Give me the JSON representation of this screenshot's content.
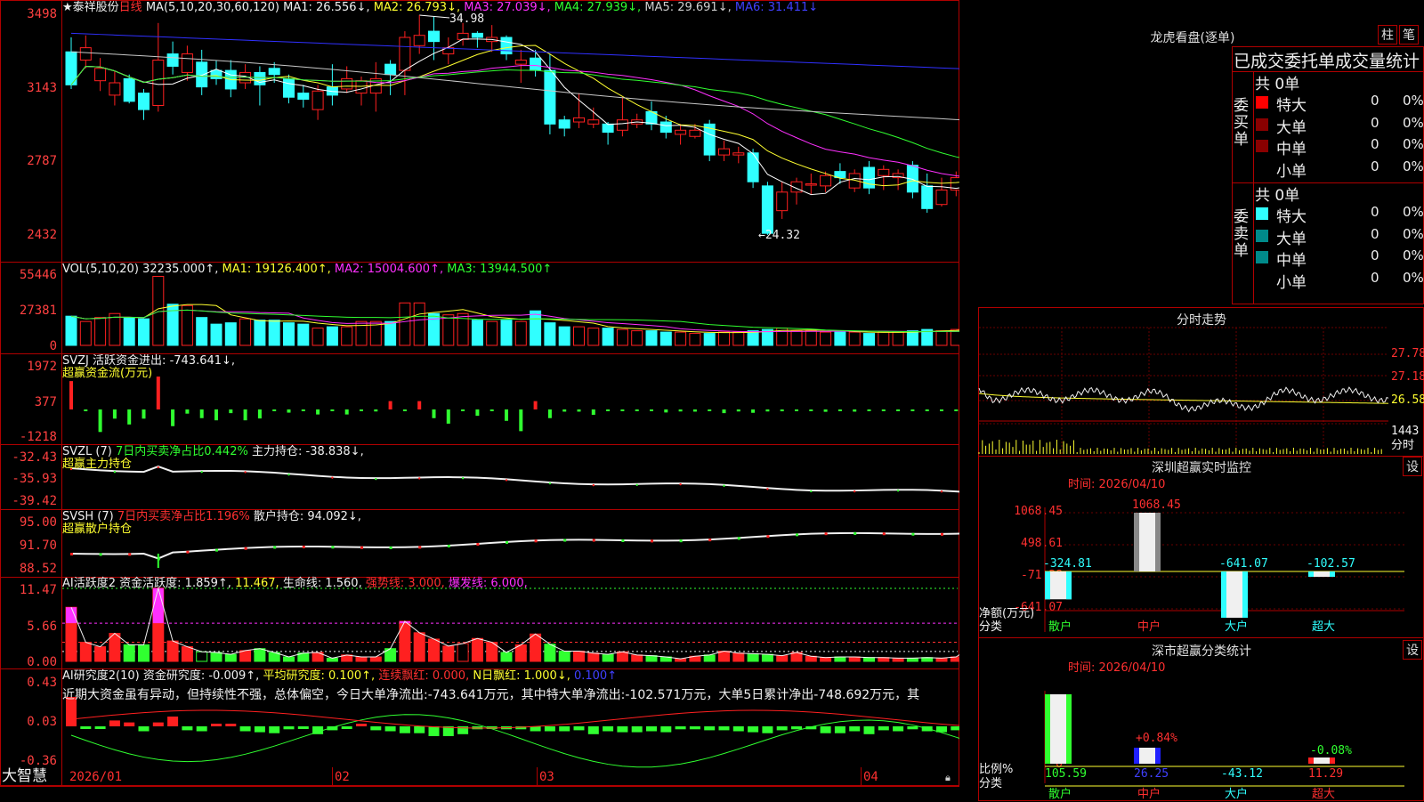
{
  "chart": {
    "title": "泰祥股份",
    "period": "日线",
    "ma_header": "MA(5,10,20,30,60,120)",
    "ma1": "MA1: 26.556↓,",
    "ma2": "MA2: 26.793↓,",
    "ma3": "MA3: 27.039↓,",
    "ma4": "MA4: 27.939↓,",
    "ma5": "MA5: 29.691↓,",
    "ma6": "MA6: 31.411↓",
    "high_label": "34.98",
    "low_label": "←24.32",
    "y_ticks": [
      "3498",
      "3143",
      "2787",
      "2432"
    ],
    "x_ticks": [
      "2026/01",
      "02",
      "03",
      "04"
    ],
    "colors": {
      "up": "#ff2020",
      "down": "#30ffff",
      "ma1": "#ffffff",
      "ma2": "#ffff30",
      "ma3": "#ff30ff",
      "ma4": "#30ff30",
      "ma5": "#c8c8c8",
      "ma6": "#3030ff"
    }
  },
  "candles": [
    [
      33.2,
      31.6,
      33.9,
      31.4
    ],
    [
      32.8,
      33.4,
      34.0,
      32.4
    ],
    [
      31.8,
      32.4,
      32.9,
      31.3
    ],
    [
      31.1,
      31.7,
      32.3,
      30.6
    ],
    [
      31.9,
      30.8,
      32.1,
      30.7
    ],
    [
      31.2,
      30.4,
      31.4,
      29.9
    ],
    [
      30.6,
      32.8,
      34.6,
      30.3
    ],
    [
      33.1,
      32.5,
      33.7,
      32.1
    ],
    [
      32.2,
      33.1,
      33.5,
      31.8
    ],
    [
      32.7,
      31.5,
      33.3,
      31.1
    ],
    [
      32.3,
      31.9,
      32.8,
      31.6
    ],
    [
      32.3,
      31.4,
      32.8,
      31.0
    ],
    [
      31.7,
      32.2,
      32.6,
      31.4
    ],
    [
      32.2,
      31.6,
      32.5,
      30.6
    ],
    [
      32.4,
      32.1,
      32.7,
      31.7
    ],
    [
      31.9,
      31.0,
      32.1,
      30.7
    ],
    [
      31.2,
      30.9,
      31.6,
      30.5
    ],
    [
      30.4,
      31.3,
      31.6,
      29.9
    ],
    [
      31.5,
      31.1,
      32.6,
      30.6
    ],
    [
      31.4,
      31.9,
      32.5,
      31.2
    ],
    [
      31.2,
      31.8,
      32.0,
      30.6
    ],
    [
      31.2,
      31.9,
      32.7,
      30.3
    ],
    [
      32.6,
      32.1,
      32.8,
      31.1
    ],
    [
      32.3,
      33.9,
      34.2,
      31.1
    ],
    [
      33.5,
      34.0,
      34.98,
      33.1
    ],
    [
      34.2,
      33.7,
      34.9,
      32.8
    ],
    [
      33.1,
      33.4,
      33.9,
      32.6
    ],
    [
      33.8,
      34.1,
      34.6,
      33.5
    ],
    [
      34.1,
      33.9,
      34.2,
      33.4
    ],
    [
      33.7,
      33.9,
      34.5,
      33.2
    ],
    [
      33.9,
      33.1,
      34.0,
      32.8
    ],
    [
      32.6,
      32.8,
      33.3,
      31.7
    ],
    [
      32.9,
      32.3,
      33.3,
      32.0
    ],
    [
      32.3,
      29.7,
      33.1,
      29.2
    ],
    [
      29.9,
      29.5,
      30.1,
      29.1
    ],
    [
      29.8,
      30.0,
      31.2,
      29.5
    ],
    [
      29.7,
      29.9,
      30.5,
      29.5
    ],
    [
      29.7,
      29.3,
      29.8,
      28.7
    ],
    [
      29.4,
      29.9,
      31.0,
      29.1
    ],
    [
      29.7,
      29.9,
      30.2,
      29.5
    ],
    [
      30.3,
      29.7,
      30.8,
      29.4
    ],
    [
      29.8,
      29.3,
      30.1,
      29.0
    ],
    [
      29.2,
      29.4,
      29.7,
      28.7
    ],
    [
      29.1,
      29.4,
      29.7,
      29.0
    ],
    [
      29.7,
      28.2,
      29.9,
      27.9
    ],
    [
      28.2,
      28.5,
      28.9,
      27.9
    ],
    [
      28.2,
      28.3,
      28.6,
      27.8
    ],
    [
      28.3,
      26.9,
      28.5,
      26.6
    ],
    [
      26.7,
      24.4,
      26.9,
      24.32
    ],
    [
      25.5,
      26.4,
      26.9,
      25.1
    ],
    [
      26.4,
      26.9,
      27.1,
      25.8
    ],
    [
      26.8,
      26.8,
      27.3,
      26.3
    ],
    [
      26.7,
      27.2,
      27.4,
      26.4
    ],
    [
      27.4,
      27.1,
      27.8,
      26.8
    ],
    [
      26.6,
      27.3,
      27.5,
      26.4
    ],
    [
      27.6,
      26.6,
      27.9,
      26.3
    ],
    [
      27.2,
      27.5,
      27.7,
      26.5
    ],
    [
      27.1,
      27.3,
      27.5,
      26.5
    ],
    [
      27.7,
      26.4,
      27.9,
      26.1
    ],
    [
      26.7,
      25.6,
      27.3,
      25.4
    ],
    [
      25.8,
      26.5,
      27.1,
      25.7
    ],
    [
      26.5,
      27.1,
      27.4,
      26.2
    ],
    [
      26.7,
      27.9,
      28.3,
      26.6
    ],
    [
      27.6,
      27.1,
      28.2,
      26.9
    ],
    [
      27.5,
      26.2,
      27.8,
      26.0
    ]
  ],
  "volume": {
    "header": "VOL(5,10,20)",
    "value": "32235.000↑,",
    "ma1": "MA1: 19126.400↑,",
    "ma2": "MA2: 15004.600↑,",
    "ma3": "MA3: 13944.500↑",
    "y_ticks": [
      "55446",
      "27381",
      "0"
    ],
    "bars": [
      22,
      18,
      21,
      24,
      21,
      20,
      52,
      31,
      30,
      21,
      16,
      17,
      20,
      19,
      19,
      17,
      16,
      13,
      14,
      14,
      18,
      18,
      18,
      32,
      32,
      24,
      23,
      24,
      19,
      18,
      19,
      18,
      26,
      17,
      14,
      14,
      13,
      13,
      12,
      11,
      11,
      10,
      10,
      9,
      9,
      10,
      10,
      11,
      12,
      13,
      11,
      11,
      10,
      10,
      10,
      9,
      10,
      10,
      11,
      12,
      11,
      12,
      14,
      19,
      31
    ]
  },
  "svzj": {
    "header": "SVZJ",
    "label": "活跃资金进出:",
    "value": "-743.641↓,",
    "subtitle": "超赢资金流(万元)",
    "y_ticks": [
      "1972",
      "377",
      "-1218"
    ],
    "bars": [
      1700,
      -80,
      -1350,
      -550,
      -900,
      -550,
      1970,
      -1000,
      -250,
      -520,
      -650,
      -220,
      -650,
      -540,
      -80,
      -190,
      -90,
      -300,
      -90,
      -300,
      -50,
      -120,
      500,
      -100,
      500,
      -520,
      -850,
      -70,
      -380,
      -100,
      -680,
      -1300,
      500,
      -520,
      -130,
      -130,
      -320,
      -100,
      -100,
      -100,
      -80,
      -180,
      -120,
      -130,
      -90,
      -220,
      -120,
      -200,
      -120,
      -110,
      -60,
      -90,
      -140,
      -80,
      -130,
      -80,
      -70,
      -90,
      -90,
      -90,
      -70,
      -80,
      -60,
      -60,
      -740
    ]
  },
  "svzl": {
    "header": "SVZL (7)",
    "label": "7日内买卖净占比0.442%",
    "label2": "主力持仓:",
    "value": "-38.838↓,",
    "subtitle": "超赢主力持仓",
    "y_ticks": [
      "-32.43",
      "-35.93",
      "-39.42"
    ]
  },
  "svsh": {
    "header": "SVSH (7)",
    "label": "7日内买卖净占比1.196%",
    "label2": "散户持仓:",
    "value": "94.092↓,",
    "subtitle": "超赢散户持仓",
    "y_ticks": [
      "95.00",
      "91.70",
      "88.52"
    ]
  },
  "ai1": {
    "header": "AI活跃度2",
    "label": "资金活跃度:",
    "v1": "1.859↑,",
    "v2": "11.467,",
    "label2": "生命线:",
    "v3": "1.560,",
    "v4": "强势线: 3.000,",
    "v5": "爆发线: 6.000,",
    "y_ticks": [
      "11.47",
      "5.66",
      "0.00"
    ],
    "bars": [
      8.5,
      3.0,
      2.3,
      4.4,
      2.6,
      2.6,
      11.5,
      3.2,
      2.3,
      1.5,
      1.4,
      1.1,
      1.7,
      2.0,
      1.4,
      0.7,
      1.3,
      1.4,
      0.5,
      1.0,
      0.7,
      0.7,
      2.0,
      6.3,
      4.5,
      3.5,
      2.4,
      2.8,
      3.6,
      3.0,
      1.4,
      2.6,
      4.3,
      2.7,
      1.6,
      1.6,
      1.3,
      1.1,
      1.5,
      1.0,
      0.9,
      0.7,
      0.4,
      0.8,
      1.0,
      1.6,
      1.3,
      1.2,
      1.1,
      0.9,
      1.4,
      0.8,
      0.6,
      0.7,
      0.7,
      0.6,
      0.6,
      0.5,
      0.5,
      0.6,
      0.5,
      0.7,
      2.2,
      1.1,
      1.9
    ]
  },
  "ai2": {
    "header": "AI研究度2(10)",
    "label": "资金研究度:",
    "v1": "-0.009↑,",
    "v2": "平均研究度: 0.100↑,",
    "v3": "连续飘红: 0.000,",
    "v4": "N日飘红: 1.000↓,",
    "v5": "0.100↑",
    "note": "近期大资金虽有异动，但持续性不强，总体偏空，今日大单净流出:-743.641万元，其中特大单净流出:-102.571万元，大单5日累计净出-748.692万元，其",
    "y_ticks": [
      "0.43",
      "0.03",
      "-0.36"
    ],
    "bars": [
      0.3,
      -0.02,
      -0.02,
      0.06,
      0.04,
      -0.05,
      0.04,
      0.1,
      -0.04,
      -0.05,
      0.02,
      0.02,
      -0.05,
      -0.06,
      -0.07,
      -0.03,
      -0.02,
      -0.08,
      -0.04,
      -0.02,
      0.0,
      -0.04,
      -0.05,
      -0.07,
      -0.07,
      -0.1,
      -0.1,
      -0.08,
      -0.03,
      -0.01,
      -0.03,
      -0.03,
      -0.05,
      -0.05,
      -0.05,
      -0.04,
      -0.08,
      -0.05,
      -0.06,
      -0.06,
      -0.05,
      -0.06,
      -0.03,
      -0.03,
      -0.04,
      -0.04,
      -0.05,
      -0.06,
      -0.07,
      -0.04,
      -0.03,
      -0.03,
      -0.07,
      -0.07,
      -0.05,
      -0.08,
      -0.04,
      -0.05,
      -0.03,
      -0.05,
      -0.06,
      -0.04,
      -0.05,
      -0.03,
      -0.03
    ]
  },
  "bottom": {
    "logo": "大智慧"
  },
  "lhb": {
    "title": "龙虎看盘(逐单)",
    "btn1": "柱",
    "btn2": "笔",
    "header": "已成交委托单成交量统计",
    "buy_label": "委买单",
    "sell_label": "委卖单",
    "buy_total": "共 0单",
    "sell_total": "共 0单",
    "rows": [
      {
        "name": "特大",
        "count": "0",
        "pct": "0%"
      },
      {
        "name": "大单",
        "count": "0",
        "pct": "0%"
      },
      {
        "name": "中单",
        "count": "0",
        "pct": "0%"
      },
      {
        "name": "小单",
        "count": "0",
        "pct": "0%"
      }
    ],
    "buy_colors": [
      "#ff0000",
      "#8a0000",
      "#8a0000",
      ""
    ],
    "sell_colors": [
      "#30ffff",
      "#008a8a",
      "#008a8a",
      ""
    ]
  },
  "fenshi": {
    "title": "分时走势",
    "y_ticks": [
      "27.78",
      "27.18",
      "26.58"
    ],
    "vol_tick": "1443",
    "xlabel": "分时"
  },
  "monitor": {
    "title": "深圳超赢实时监控",
    "btn": "设",
    "time": "时间: 2026/04/10",
    "y_ticks": [
      "1068.45",
      "498.61",
      "-71.28",
      "-641.07"
    ],
    "ylabel": "净额(万元)",
    "xlabel": "分类",
    "cats": [
      "散户",
      "中户",
      "大户",
      "超大"
    ],
    "values": [
      "-324.81",
      "1068.45",
      "-641.07",
      "-102.57"
    ]
  },
  "classify": {
    "title": "深市超赢分类统计",
    "btn": "设",
    "time": "时间: 2026/04/10",
    "y_ticks": [
      "75",
      "50",
      "25",
      "0"
    ],
    "ylabel": "比例%",
    "xlabel": "分类",
    "cats": [
      "散户",
      "中户",
      "大户",
      "超大"
    ],
    "values": [
      "105.59",
      "26.25",
      "-43.12",
      "11.29"
    ],
    "annot": [
      "+0.84%",
      "-0.08%"
    ]
  }
}
